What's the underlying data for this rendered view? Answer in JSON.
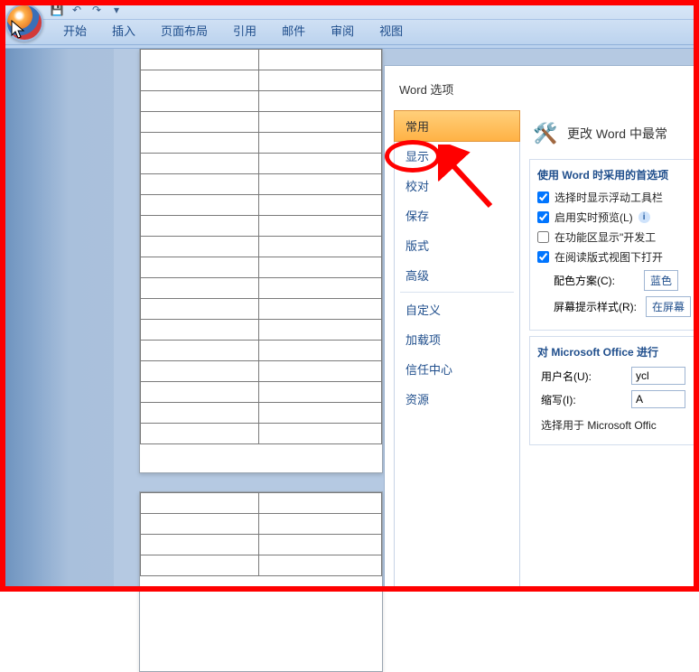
{
  "ribbon_tabs": [
    "开始",
    "插入",
    "页面布局",
    "引用",
    "邮件",
    "审阅",
    "视图"
  ],
  "options": {
    "title": "Word 选项",
    "nav": [
      "常用",
      "显示",
      "校对",
      "保存",
      "版式",
      "高级",
      "自定义",
      "加载项",
      "信任中心",
      "资源"
    ],
    "nav_selected": "常用",
    "heading": "更改 Word 中最常",
    "section1": {
      "head": "使用 Word 时采用的首选项",
      "c1": {
        "checked": true,
        "label": "选择时显示浮动工具栏"
      },
      "c2": {
        "checked": true,
        "label": "启用实时预览(L)"
      },
      "c3": {
        "checked": false,
        "label": "在功能区显示\"开发工"
      },
      "c4": {
        "checked": true,
        "label": "在阅读版式视图下打开"
      },
      "color_label": "配色方案(C):",
      "color_value": "蓝色",
      "tip_label": "屏幕提示样式(R):",
      "tip_value": "在屏幕"
    },
    "section2": {
      "head": "对 Microsoft Office 进行",
      "user_label": "用户名(U):",
      "user_value": "ycl",
      "init_label": "缩写(I):",
      "init_value": "A",
      "footer": "选择用于 Microsoft Offic"
    }
  }
}
